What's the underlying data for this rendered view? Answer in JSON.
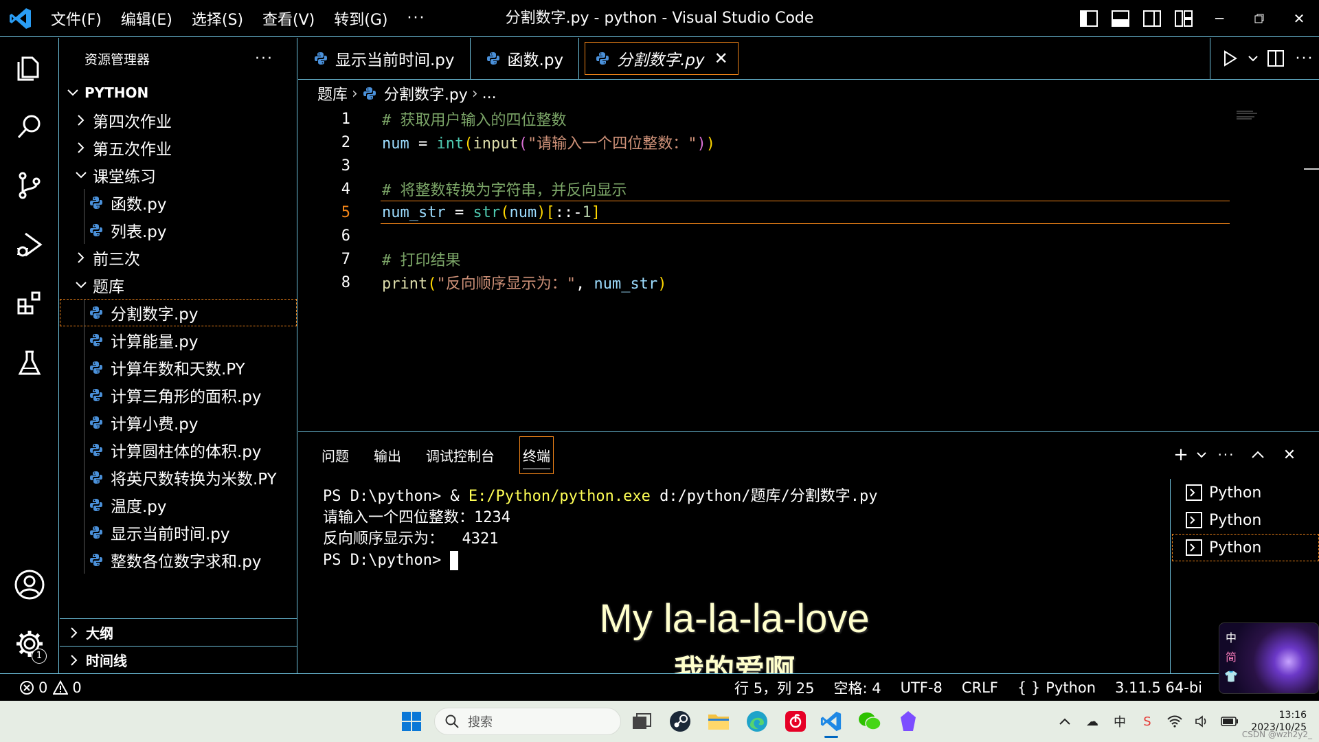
{
  "window": {
    "title": "分割数字.py - python - Visual Studio Code",
    "menu": [
      "文件(F)",
      "编辑(E)",
      "选择(S)",
      "查看(V)",
      "转到(G)"
    ],
    "menu_more": "···"
  },
  "sidebar": {
    "header": "资源管理器",
    "more": "···",
    "root": "PYTHON",
    "items": [
      {
        "label": "第四次作业",
        "type": "folder",
        "expanded": false,
        "depth": 1
      },
      {
        "label": "第五次作业",
        "type": "folder",
        "expanded": false,
        "depth": 1
      },
      {
        "label": "课堂练习",
        "type": "folder",
        "expanded": true,
        "depth": 1
      },
      {
        "label": "函数.py",
        "type": "file",
        "depth": 2
      },
      {
        "label": "列表.py",
        "type": "file",
        "depth": 2
      },
      {
        "label": "前三次",
        "type": "folder",
        "expanded": false,
        "depth": 1
      },
      {
        "label": "题库",
        "type": "folder",
        "expanded": true,
        "depth": 1
      },
      {
        "label": "分割数字.py",
        "type": "file",
        "depth": 2,
        "selected": true
      },
      {
        "label": "计算能量.py",
        "type": "file",
        "depth": 2
      },
      {
        "label": "计算年数和天数.PY",
        "type": "file",
        "depth": 2
      },
      {
        "label": "计算三角形的面积.py",
        "type": "file",
        "depth": 2
      },
      {
        "label": "计算小费.py",
        "type": "file",
        "depth": 2
      },
      {
        "label": "计算圆柱体的体积.py",
        "type": "file",
        "depth": 2
      },
      {
        "label": "将英尺数转换为米数.PY",
        "type": "file",
        "depth": 2
      },
      {
        "label": "温度.py",
        "type": "file",
        "depth": 2
      },
      {
        "label": "显示当前时间.py",
        "type": "file",
        "depth": 2
      },
      {
        "label": "整数各位数字求和.py",
        "type": "file",
        "depth": 2
      }
    ],
    "outline": "大纲",
    "timeline": "时间线"
  },
  "tabs": [
    {
      "label": "显示当前时间.py",
      "active": false
    },
    {
      "label": "函数.py",
      "active": false
    },
    {
      "label": "分割数字.py",
      "active": true
    }
  ],
  "breadcrumb": {
    "folder": "题库",
    "file": "分割数字.py",
    "tail": "..."
  },
  "code": {
    "current_line": 5,
    "lines": [
      {
        "n": "1",
        "tokens": [
          {
            "t": "# 获取用户输入的四位整数",
            "c": "cmt"
          }
        ]
      },
      {
        "n": "2",
        "tokens": [
          {
            "t": "num",
            "c": "var"
          },
          {
            "t": " = ",
            "c": "op"
          },
          {
            "t": "int",
            "c": "builtin"
          },
          {
            "t": "(",
            "c": "paren"
          },
          {
            "t": "input",
            "c": "fn"
          },
          {
            "t": "(",
            "c": "paren2"
          },
          {
            "t": "\"请输入一个四位整数：\"",
            "c": "str"
          },
          {
            "t": ")",
            "c": "paren2"
          },
          {
            "t": ")",
            "c": "paren"
          }
        ]
      },
      {
        "n": "3",
        "tokens": []
      },
      {
        "n": "4",
        "tokens": [
          {
            "t": "# 将整数转换为字符串，并反向显示",
            "c": "cmt"
          }
        ]
      },
      {
        "n": "5",
        "tokens": [
          {
            "t": "num_str",
            "c": "var"
          },
          {
            "t": " = ",
            "c": "op"
          },
          {
            "t": "str",
            "c": "builtin"
          },
          {
            "t": "(",
            "c": "paren"
          },
          {
            "t": "num",
            "c": "var"
          },
          {
            "t": ")",
            "c": "paren"
          },
          {
            "t": "[",
            "c": "paren"
          },
          {
            "t": "::-",
            "c": "op"
          },
          {
            "t": "1",
            "c": "num"
          },
          {
            "t": "]",
            "c": "paren"
          }
        ]
      },
      {
        "n": "6",
        "tokens": []
      },
      {
        "n": "7",
        "tokens": [
          {
            "t": "# 打印结果",
            "c": "cmt"
          }
        ]
      },
      {
        "n": "8",
        "tokens": [
          {
            "t": "print",
            "c": "fn"
          },
          {
            "t": "(",
            "c": "paren"
          },
          {
            "t": "\"反向顺序显示为：\"",
            "c": "str"
          },
          {
            "t": ", ",
            "c": "op"
          },
          {
            "t": "num_str",
            "c": "var"
          },
          {
            "t": ")",
            "c": "paren"
          }
        ]
      }
    ]
  },
  "panel": {
    "tabs": [
      "问题",
      "输出",
      "调试控制台",
      "终端"
    ],
    "active_tab": "终端",
    "terminal": {
      "line1_prompt": "PS D:\\python> & ",
      "line1_exe": "E:/Python/python.exe",
      "line1_arg": " d:/python/题库/分割数字.py",
      "line2": "请输入一个四位整数：1234",
      "line3": "反向顺序显示为：  4321",
      "line4_prompt": "PS D:\\python> "
    },
    "lyrics": {
      "line1": "My la-la-la-love",
      "line2": "我的爱啊"
    },
    "terminals": [
      "Python",
      "Python",
      "Python"
    ]
  },
  "statusbar": {
    "errors": "0",
    "warnings": "0",
    "position": "行 5，列 25",
    "spaces": "空格: 4",
    "encoding": "UTF-8",
    "eol": "CRLF",
    "language": "Python",
    "interpreter": "3.11.5 64-bi"
  },
  "taskbar": {
    "search_placeholder": "搜索",
    "time": "13:16",
    "date": "2023/10/25",
    "watermark": "CSDN @wzh2y2_"
  },
  "ime": {
    "mode1": "中",
    "mode2": "简"
  },
  "colors": {
    "accent_border": "#6fc3df",
    "focus_border": "#f38518",
    "comment": "#7ca668",
    "variable": "#9cdcfe",
    "string": "#ce9178"
  }
}
